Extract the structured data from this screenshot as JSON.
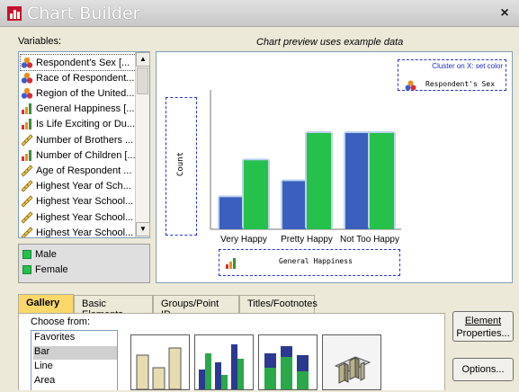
{
  "window": {
    "title": "Chart Builder",
    "close_glyph": "×"
  },
  "variables": {
    "label": "Variables:",
    "items": [
      {
        "label": "Respondent's Sex [...",
        "icon": "nominal-icon"
      },
      {
        "label": "Race of Respondent...",
        "icon": "nominal-icon"
      },
      {
        "label": "Region of the United...",
        "icon": "nominal-icon"
      },
      {
        "label": "General Happiness [...",
        "icon": "ordinal-icon"
      },
      {
        "label": "Is Life Exciting or Du...",
        "icon": "ordinal-icon"
      },
      {
        "label": "Number of Brothers ...",
        "icon": "scale-icon"
      },
      {
        "label": "Number of Children [...",
        "icon": "ordinal-icon"
      },
      {
        "label": "Age of Respondent ...",
        "icon": "scale-icon"
      },
      {
        "label": "Highest Year of Sch...",
        "icon": "scale-icon"
      },
      {
        "label": "Highest Year School...",
        "icon": "scale-icon"
      },
      {
        "label": "Highest Year School...",
        "icon": "scale-icon"
      },
      {
        "label": "Highest Year School...",
        "icon": "scale-icon"
      }
    ]
  },
  "categories": {
    "items": [
      "Male",
      "Female"
    ]
  },
  "preview": {
    "caption": "Chart preview uses example data",
    "cluster_label": "Cluster on X: set color",
    "cluster_variable": "Respondent's Sex",
    "y_axis_label": "Count",
    "x_axis_variable": "General Happiness"
  },
  "chart_data": {
    "type": "bar",
    "categories": [
      "Very Happy",
      "Pretty Happy",
      "Not Too Happy"
    ],
    "series": [
      {
        "values": [
          2,
          3,
          6
        ]
      },
      {
        "values": [
          4.3,
          6,
          6
        ]
      }
    ],
    "colors": [
      "#3a5fbf",
      "#25c14a"
    ],
    "xlabel": "General Happiness",
    "ylabel": "Count",
    "legend": "top-right"
  },
  "tabs": [
    "Gallery",
    "Basic Elements",
    "Groups/Point ID",
    "Titles/Footnotes"
  ],
  "gallery": {
    "choose_label": "Choose from:",
    "items": [
      "Favorites",
      "Bar",
      "Line",
      "Area"
    ],
    "selected": "Bar"
  },
  "buttons": {
    "element_properties_line1": "Element",
    "element_properties_line2": "Properties...",
    "options": "Options..."
  },
  "colors": {
    "accent_tab": "#fcd86a",
    "dash_border": "#2233cc"
  }
}
